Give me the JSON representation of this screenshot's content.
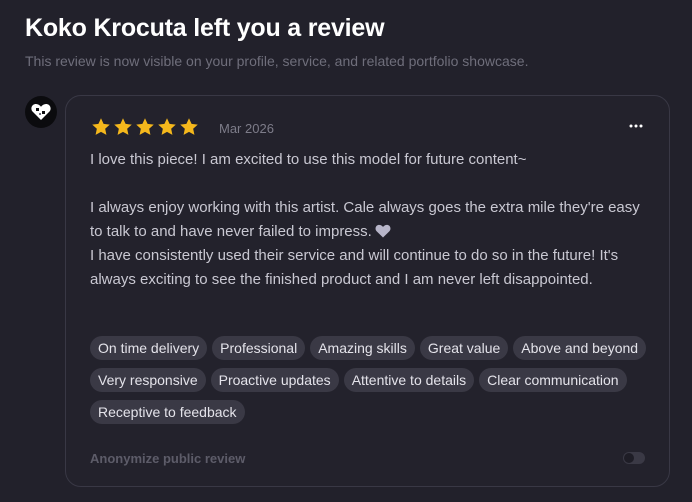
{
  "header": {
    "title": "Koko Krocuta left you a review",
    "subtitle": "This review is now visible on your profile, service, and related portfolio showcase."
  },
  "review": {
    "rating": 5,
    "rating_max": 5,
    "date": "Mar 2026",
    "paragraphs": [
      "I love this piece! I am excited to use this model for future content~",
      "I always enjoy working with this artist. Cale always goes the extra mile they're easy to talk to and have never failed to impress.",
      "I have consistently used their service and will continue to do so in the future! It's always exciting to see the finished product and I am never left disappointed."
    ],
    "tags": [
      "On time delivery",
      "Professional",
      "Amazing skills",
      "Great value",
      "Above and beyond",
      "Very responsive",
      "Proactive updates",
      "Attentive to details",
      "Clear communication",
      "Receptive to feedback"
    ]
  },
  "anonymize": {
    "label": "Anonymize public review",
    "enabled": false
  },
  "icons": {
    "avatar": "heart-logo-icon",
    "star": "star-icon",
    "more": "more-horizontal-icon",
    "heart": "heart-icon"
  },
  "colors": {
    "star": "#f5b81c",
    "heart": "#b7b5c9",
    "background": "#22212b",
    "tag_background": "#3a3945"
  }
}
